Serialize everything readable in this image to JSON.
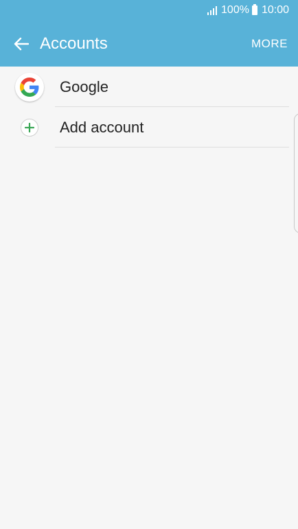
{
  "status_bar": {
    "battery_percent": "100%",
    "time": "10:00",
    "icons": [
      "signal-icon",
      "battery-icon"
    ]
  },
  "app_bar": {
    "title": "Accounts",
    "more_label": "MORE",
    "back_icon": "back-arrow-icon"
  },
  "accounts": {
    "items": [
      {
        "label": "Google",
        "icon": "google-logo-icon"
      },
      {
        "label": "Add account",
        "icon": "plus-icon"
      }
    ]
  },
  "colors": {
    "accent": "#58b2d8",
    "background": "#f6f6f6",
    "plus": "#3aa655"
  }
}
